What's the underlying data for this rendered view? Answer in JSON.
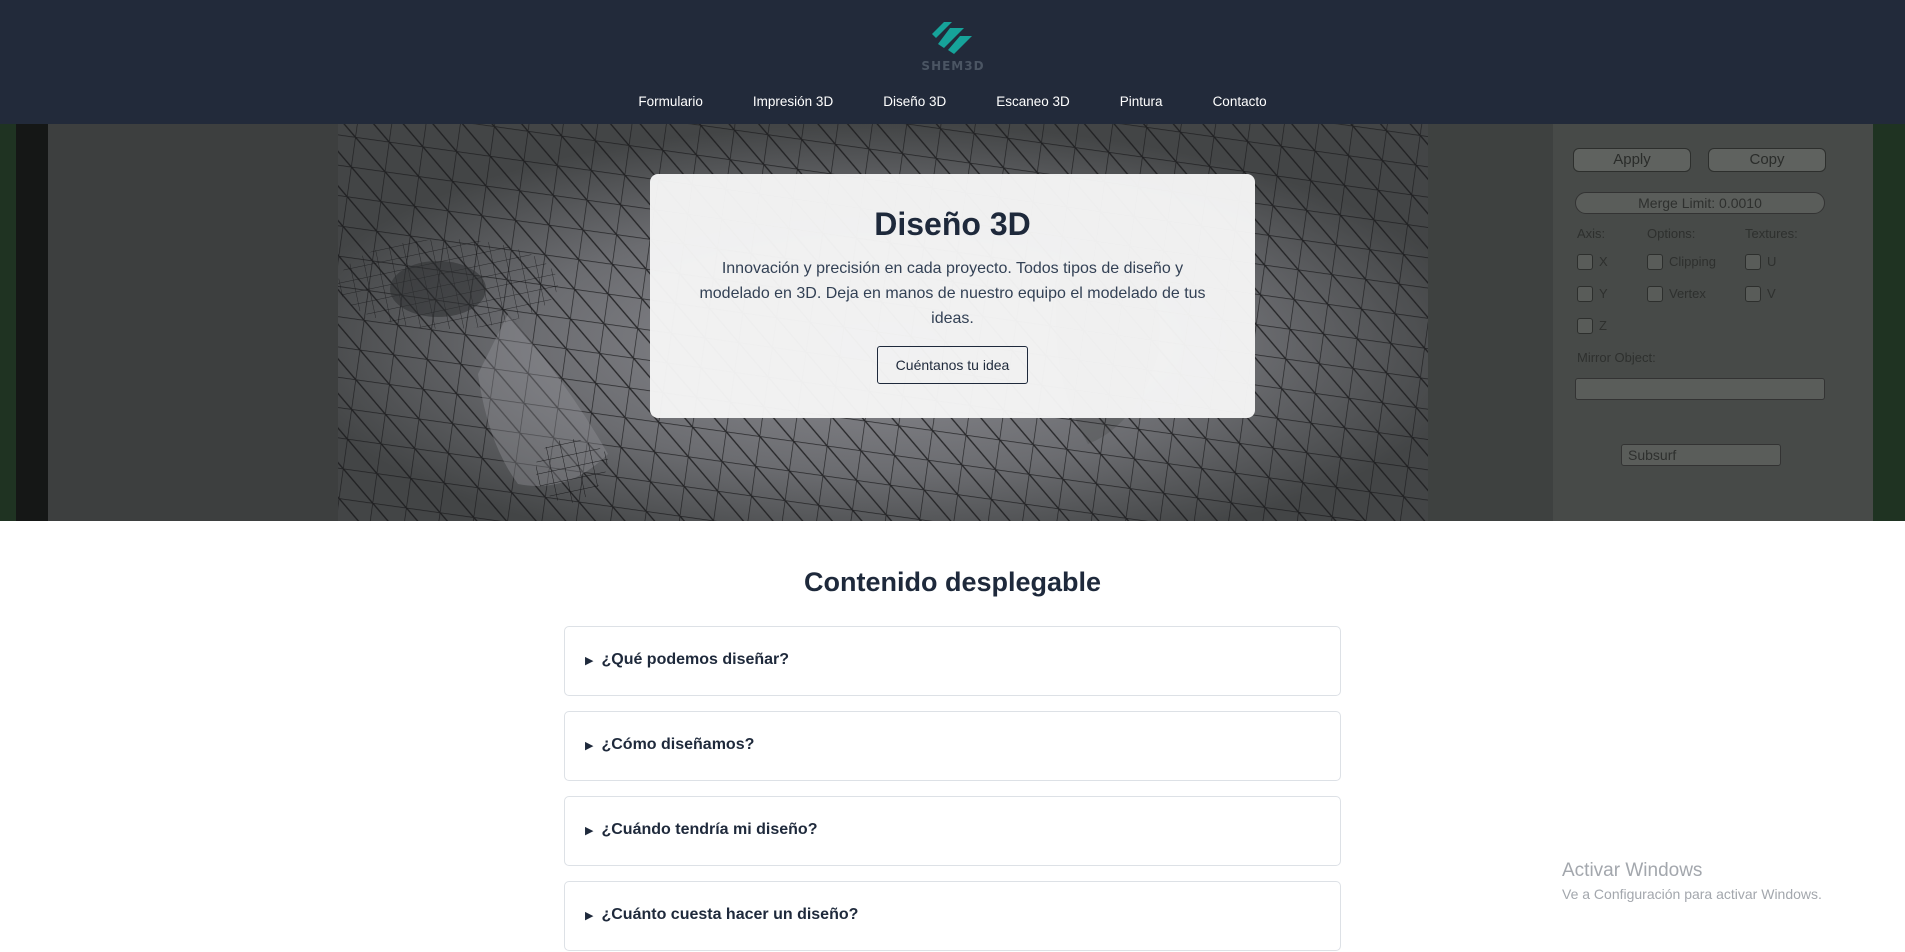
{
  "brand": {
    "name": "SHEM3D",
    "accent": "#16a39a"
  },
  "nav": {
    "items": [
      {
        "label": "Formulario"
      },
      {
        "label": "Impresión 3D"
      },
      {
        "label": "Diseño 3D"
      },
      {
        "label": "Escaneo 3D"
      },
      {
        "label": "Pintura"
      },
      {
        "label": "Contacto"
      }
    ]
  },
  "hero": {
    "title": "Diseño 3D",
    "description": "Innovación y precisión en cada proyecto. Todos tipos de diseño y modelado en 3D. Deja en manos de nuestro equipo el modelado de tus ideas.",
    "cta_label": "Cuéntanos tu idea",
    "image_panel": {
      "apply": "Apply",
      "copy": "Copy",
      "merge_limit": "Merge Limit: 0.0010",
      "axis": "Axis:",
      "options": "Options:",
      "textures": "Textures:",
      "x": "X",
      "y": "Y",
      "z": "Z",
      "clipping": "Clipping",
      "vertex": "Vertex",
      "u": "U",
      "v": "V",
      "mirror_object": "Mirror Object:",
      "subsurf": "Subsurf"
    }
  },
  "faq": {
    "title": "Contenido desplegable",
    "items": [
      {
        "question": "¿Qué podemos diseñar?"
      },
      {
        "question": "¿Cómo diseñamos?"
      },
      {
        "question": "¿Cuándo tendría mi diseño?"
      },
      {
        "question": "¿Cuánto cuesta hacer un diseño?"
      }
    ]
  },
  "watermark": {
    "line1": "Activar Windows",
    "line2": "Ve a Configuración para activar Windows."
  }
}
